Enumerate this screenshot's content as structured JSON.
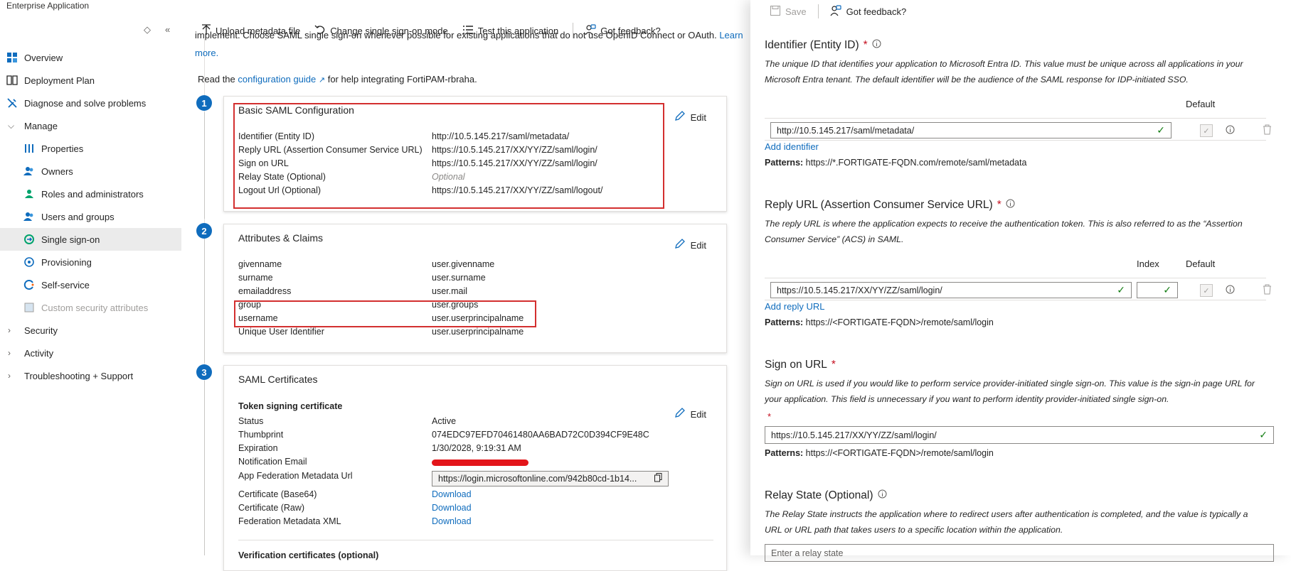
{
  "app": {
    "title": "Enterprise Application"
  },
  "sidebar": {
    "items": [
      {
        "label": "Overview"
      },
      {
        "label": "Deployment Plan"
      },
      {
        "label": "Diagnose and solve problems"
      },
      {
        "label": "Manage"
      },
      {
        "label": "Properties"
      },
      {
        "label": "Owners"
      },
      {
        "label": "Roles and administrators"
      },
      {
        "label": "Users and groups"
      },
      {
        "label": "Single sign-on"
      },
      {
        "label": "Provisioning"
      },
      {
        "label": "Self-service"
      },
      {
        "label": "Custom security attributes"
      },
      {
        "label": "Security"
      },
      {
        "label": "Activity"
      },
      {
        "label": "Troubleshooting + Support"
      }
    ],
    "selected": "Single sign-on"
  },
  "toolbar": {
    "upload": "Upload metadata file",
    "change_mode": "Change single sign-on mode",
    "test": "Test this application",
    "feedback": "Got feedback?"
  },
  "intro": {
    "cut_line": "implement. Choose SAML single sign-on whenever possible for existing applications that do not use OpenID Connect or OAuth.",
    "learn": "Learn",
    "more": "more.",
    "read_prefix": "Read the",
    "guide_link": "configuration guide",
    "read_suffix": "for help integrating FortiPAM-rbraha."
  },
  "steps": [
    "1",
    "2",
    "3"
  ],
  "basic_saml": {
    "title": "Basic SAML Configuration",
    "edit": "Edit",
    "rows": [
      {
        "k": "Identifier (Entity ID)",
        "v": "http://10.5.145.217/saml/metadata/"
      },
      {
        "k": "Reply URL (Assertion Consumer Service URL)",
        "v": "https://10.5.145.217/XX/YY/ZZ/saml/login/"
      },
      {
        "k": "Sign on URL",
        "v": "https://10.5.145.217/XX/YY/ZZ/saml/login/"
      },
      {
        "k": "Relay State (Optional)",
        "v": "Optional"
      },
      {
        "k": "Logout Url (Optional)",
        "v": "https://10.5.145.217/XX/YY/ZZ/saml/logout/"
      }
    ]
  },
  "attributes": {
    "title": "Attributes & Claims",
    "edit": "Edit",
    "rows": [
      {
        "k": "givenname",
        "v": "user.givenname"
      },
      {
        "k": "surname",
        "v": "user.surname"
      },
      {
        "k": "emailaddress",
        "v": "user.mail"
      },
      {
        "k": "group",
        "v": "user.groups"
      },
      {
        "k": "username",
        "v": "user.userprincipalname"
      },
      {
        "k": "Unique User Identifier",
        "v": "user.userprincipalname"
      }
    ]
  },
  "certs": {
    "title": "SAML Certificates",
    "subtitle": "Token signing certificate",
    "edit": "Edit",
    "status_k": "Status",
    "status_v": "Active",
    "thumb_k": "Thumbprint",
    "thumb_v": "074EDC97EFD70461480AA6BAD72C0D394CF9E48C",
    "exp_k": "Expiration",
    "exp_v": "1/30/2028, 9:19:31 AM",
    "email_k": "Notification Email",
    "meta_k": "App Federation Metadata Url",
    "meta_v": "https://login.microsoftonline.com/942b80cd-1b14...",
    "b64_k": "Certificate (Base64)",
    "raw_k": "Certificate (Raw)",
    "xml_k": "Federation Metadata XML",
    "download": "Download",
    "next_cut": "Verification certificates (optional)"
  },
  "panel": {
    "save": "Save",
    "feedback": "Got feedback?",
    "identifier": {
      "title": "Identifier (Entity ID)",
      "desc": "The unique ID that identifies your application to Microsoft Entra ID. This value must be unique across all applications in your Microsoft Entra tenant. The default identifier will be the audience of the SAML response for IDP-initiated SSO.",
      "default_hdr": "Default",
      "value": "http://10.5.145.217/saml/metadata/",
      "add": "Add identifier",
      "patterns_label": "Patterns:",
      "patterns": "https://*.FORTIGATE-FQDN.com/remote/saml/metadata"
    },
    "reply": {
      "title": "Reply URL (Assertion Consumer Service URL)",
      "desc": "The reply URL is where the application expects to receive the authentication token. This is also referred to as the “Assertion Consumer Service” (ACS) in SAML.",
      "index_hdr": "Index",
      "default_hdr": "Default",
      "value": "https://10.5.145.217/XX/YY/ZZ/saml/login/",
      "add": "Add reply URL",
      "patterns_label": "Patterns:",
      "patterns": "https://<FORTIGATE-FQDN>/remote/saml/login"
    },
    "signon": {
      "title": "Sign on URL",
      "desc": "Sign on URL is used if you would like to perform service provider-initiated single sign-on. This value is the sign-in page URL for your application. This field is unnecessary if you want to perform identity provider-initiated single sign-on.",
      "value": "https://10.5.145.217/XX/YY/ZZ/saml/login/",
      "patterns_label": "Patterns:",
      "patterns": "https://<FORTIGATE-FQDN>/remote/saml/login"
    },
    "relay": {
      "title": "Relay State (Optional)",
      "desc": "The Relay State instructs the application where to redirect users after authentication is completed, and the value is typically a URL or URL path that takes users to a specific location within the application.",
      "placeholder": "Enter a relay state"
    }
  },
  "colors": {
    "accent": "#0f6cbd",
    "highlight": "#d32f2f",
    "success": "#107c10",
    "required": "#c50f1f"
  }
}
